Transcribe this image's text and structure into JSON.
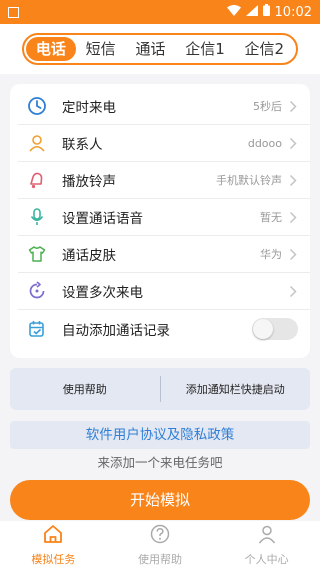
{
  "status_bar": {
    "time": "10:02",
    "icons": [
      "wifi-icon",
      "signal-icon",
      "battery-icon"
    ]
  },
  "tabs": [
    {
      "label": "电话",
      "active": true
    },
    {
      "label": "短信",
      "active": false
    },
    {
      "label": "通话",
      "active": false
    },
    {
      "label": "企信1",
      "active": false
    },
    {
      "label": "企信2",
      "active": false
    }
  ],
  "settings": {
    "rows": [
      {
        "icon": "clock-icon",
        "label": "定时来电",
        "value": "5秒后"
      },
      {
        "icon": "contact-icon",
        "label": "联系人",
        "value": "ddooo"
      },
      {
        "icon": "bell-icon",
        "label": "播放铃声",
        "value": "手机默认铃声"
      },
      {
        "icon": "microphone-icon",
        "label": "设置通话语音",
        "value": "暂无"
      },
      {
        "icon": "shirt-icon",
        "label": "通话皮肤",
        "value": "华为"
      },
      {
        "icon": "repeat-icon",
        "label": "设置多次来电",
        "value": ""
      },
      {
        "icon": "calendar-icon",
        "label": "自动添加通话记录",
        "toggle_on": false
      }
    ]
  },
  "help_bar": {
    "left": "使用帮助",
    "right": "添加通知栏快捷启动"
  },
  "policy_link": "软件用户协议及隐私政策",
  "hint": "来添加一个来电任务吧",
  "start_button": "开始模拟",
  "bottom_nav": [
    {
      "icon": "home-icon",
      "label": "模拟任务",
      "active": true
    },
    {
      "icon": "help-icon",
      "label": "使用帮助",
      "active": false
    },
    {
      "icon": "user-icon",
      "label": "个人中心",
      "active": false
    }
  ],
  "colors": {
    "accent": "#f8841a",
    "link": "#2f7fd6",
    "panel": "#e4e8f2"
  }
}
